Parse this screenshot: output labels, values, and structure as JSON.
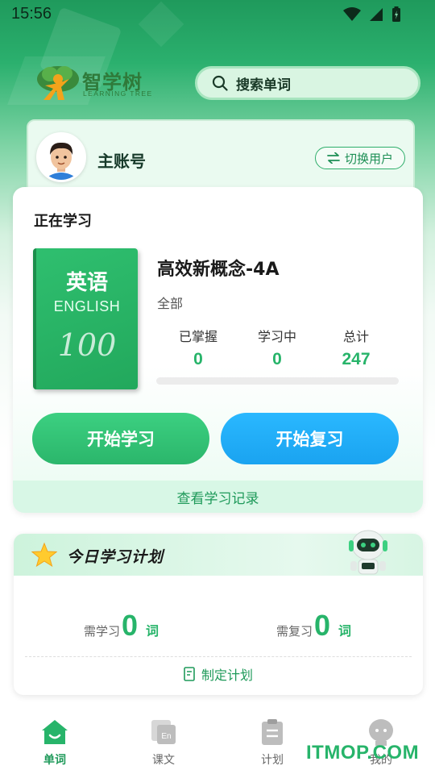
{
  "status_bar": {
    "time": "15:56"
  },
  "header": {
    "logo_title": "智学树",
    "logo_subtitle": "LEARNING TREE",
    "search_placeholder": "搜索单词"
  },
  "account": {
    "name": "主账号",
    "switch_label": "切换用户"
  },
  "study": {
    "section_title": "正在学习",
    "book_cover": {
      "subject": "英语",
      "subject_en": "ENGLISH",
      "badge": "100"
    },
    "book_title": "高效新概念-4A",
    "filter": "全部",
    "stats": [
      {
        "label": "已掌握",
        "value": "0"
      },
      {
        "label": "学习中",
        "value": "0"
      },
      {
        "label": "总计",
        "value": "247"
      }
    ],
    "progress": 0,
    "start_learn": "开始学习",
    "start_review": "开始复习",
    "view_records": "查看学习记录"
  },
  "plan": {
    "title": "今日学习计划",
    "learn_label": "需学习",
    "learn_count": "0",
    "learn_unit": "词",
    "review_label": "需复习",
    "review_count": "0",
    "review_unit": "词",
    "action": "制定计划"
  },
  "nav": {
    "items": [
      {
        "label": "单词",
        "icon": "home-icon",
        "active": true
      },
      {
        "label": "课文",
        "icon": "text-en-icon",
        "active": false
      },
      {
        "label": "计划",
        "icon": "clipboard-icon",
        "active": false
      },
      {
        "label": "我的",
        "icon": "user-face-icon",
        "active": false
      }
    ]
  },
  "watermark": "ITMOP.COM",
  "colors": {
    "primary": "#27b46a",
    "review": "#1aa3f0"
  }
}
